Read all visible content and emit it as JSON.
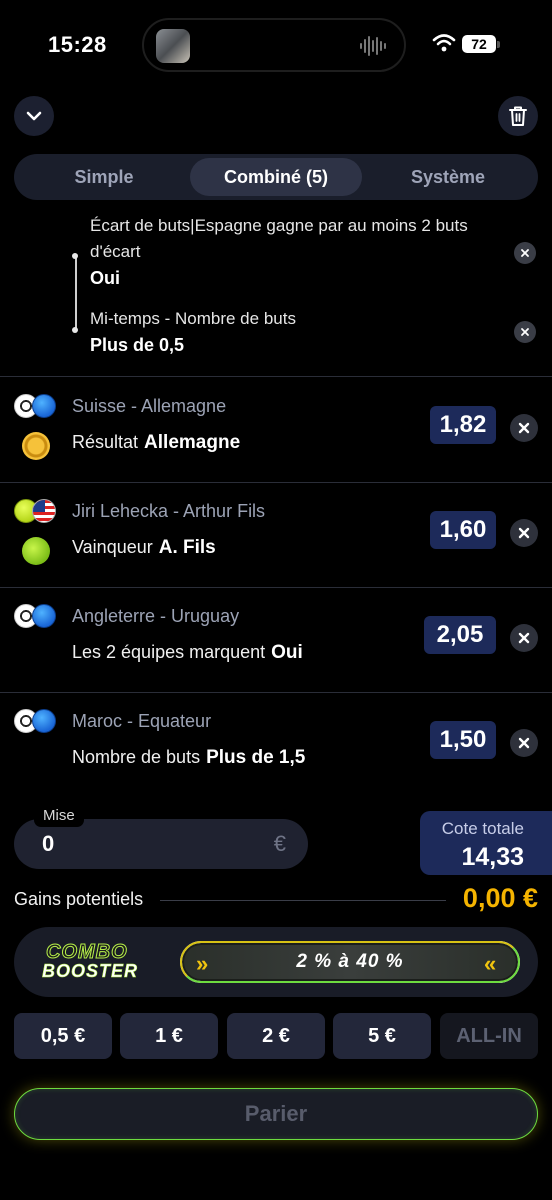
{
  "status": {
    "time": "15:28",
    "battery": "72"
  },
  "tabs": [
    {
      "label": "Simple",
      "active": false
    },
    {
      "label": "Combiné (5)",
      "active": true
    },
    {
      "label": "Système",
      "active": false
    }
  ],
  "sub_selections": [
    {
      "market_line1": "Écart de buts|Espagne gagne par au moins 2 buts",
      "market_line2": "d'écart",
      "selection": "Oui"
    },
    {
      "market_line1": "Mi-temps - Nombre de buts",
      "selection": "Plus de 0,5"
    }
  ],
  "bets": [
    {
      "match": "Suisse - Allemagne",
      "market": "Résultat",
      "selection": "Allemagne",
      "odd": "1,82",
      "sport_icon": "soccer-ball-icon",
      "region_icon": "globe-icon",
      "market_icon": "result-icon"
    },
    {
      "match": "Jiri Lehecka - Arthur Fils",
      "market": "Vainqueur",
      "selection": "A. Fils",
      "odd": "1,60",
      "sport_icon": "tennis-ball-icon",
      "region_icon": "usa-flag-icon",
      "market_icon": "winner-icon"
    },
    {
      "match": "Angleterre - Uruguay",
      "market": "Les 2 équipes marquent",
      "selection": "Oui",
      "odd": "2,05",
      "sport_icon": "soccer-ball-icon",
      "region_icon": "globe-icon"
    },
    {
      "match": "Maroc - Equateur",
      "market": "Nombre de buts",
      "selection": "Plus de 1,5",
      "odd": "1,50",
      "sport_icon": "soccer-ball-icon",
      "region_icon": "globe-icon"
    }
  ],
  "stake": {
    "label": "Mise",
    "value": "0",
    "currency": "€"
  },
  "total": {
    "label": "Cote totale",
    "value": "14,33"
  },
  "gains": {
    "label": "Gains potentiels",
    "value": "0,00 €"
  },
  "booster": {
    "logo_line1": "COMBO",
    "logo_line2": "BOOSTER",
    "text": "2 % à 40 %"
  },
  "quick_stakes": [
    "0,5 €",
    "1 €",
    "2 €",
    "5 €",
    "ALL-IN"
  ],
  "bet_button": "Parier",
  "colors": {
    "accent": "#f5b400",
    "odd_bg": "#1d2a5a",
    "booster_green": "#6ddb3f",
    "booster_yellow": "#d7c214"
  }
}
